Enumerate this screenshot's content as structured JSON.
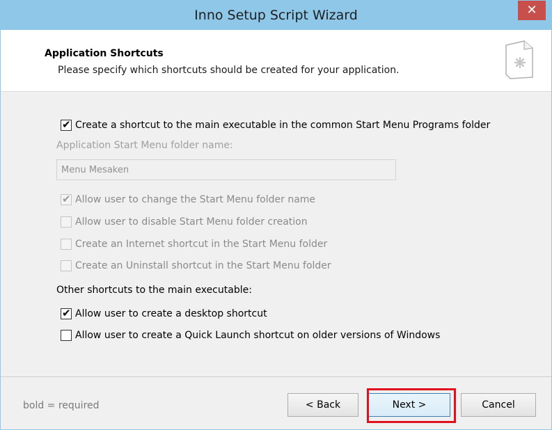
{
  "window": {
    "title": "Inno Setup Script Wizard",
    "close_label": "✕"
  },
  "header": {
    "title": "Application Shortcuts",
    "subtitle": "Please specify which shortcuts should be created for your application."
  },
  "options": {
    "create_main_shortcut": {
      "label": "Create a shortcut to the main executable in the common Start Menu Programs folder",
      "checked": true,
      "enabled": true
    },
    "folder_name_label": "Application Start Menu folder name:",
    "folder_name_value": "Menu Mesaken",
    "allow_change_folder": {
      "label": "Allow user to change the Start Menu folder name",
      "checked": true,
      "enabled": false
    },
    "allow_disable_folder": {
      "label": "Allow user to disable Start Menu folder creation",
      "checked": false,
      "enabled": false
    },
    "internet_shortcut": {
      "label": "Create an Internet shortcut in the Start Menu folder",
      "checked": false,
      "enabled": false
    },
    "uninstall_shortcut": {
      "label": "Create an Uninstall shortcut in the Start Menu folder",
      "checked": false,
      "enabled": false
    },
    "other_shortcuts_label": "Other shortcuts to the main executable:",
    "desktop_shortcut": {
      "label": "Allow user to create a desktop shortcut",
      "checked": true,
      "enabled": true
    },
    "quick_launch_shortcut": {
      "label": "Allow user to create a Quick Launch shortcut on older versions of Windows",
      "checked": false,
      "enabled": true
    }
  },
  "footer": {
    "note": "bold = required",
    "back_label": "< Back",
    "next_label": "Next >",
    "cancel_label": "Cancel"
  },
  "icons": {
    "checkmark": "✔",
    "header_icon": "document-gear-icon"
  },
  "colors": {
    "titlebar": "#8fc7e8",
    "close": "#c7504c",
    "highlight": "#e0101c"
  }
}
